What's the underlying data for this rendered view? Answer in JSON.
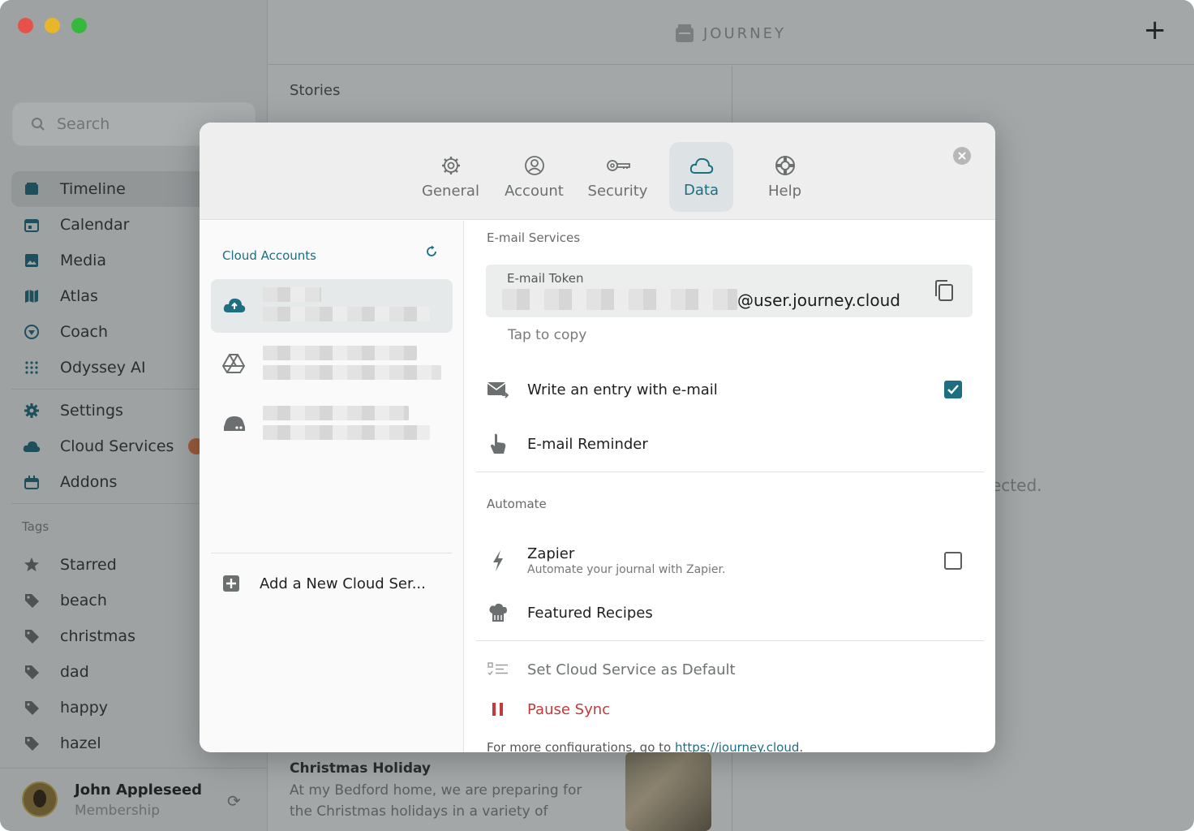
{
  "window": {
    "brand": "JOURNEY"
  },
  "sidebar": {
    "search_placeholder": "Search",
    "nav": [
      {
        "label": "Timeline",
        "icon": "timeline-icon"
      },
      {
        "label": "Calendar",
        "icon": "calendar-icon"
      },
      {
        "label": "Media",
        "icon": "media-icon"
      },
      {
        "label": "Atlas",
        "icon": "atlas-icon"
      },
      {
        "label": "Coach",
        "icon": "coach-icon"
      },
      {
        "label": "Odyssey AI",
        "icon": "odyssey-icon"
      }
    ],
    "nav2": [
      {
        "label": "Settings",
        "icon": "gear-icon"
      },
      {
        "label": "Cloud Services",
        "icon": "cloud-icon"
      },
      {
        "label": "Addons",
        "icon": "addons-icon"
      }
    ],
    "tags_title": "Tags",
    "tags": [
      "Starred",
      "beach",
      "christmas",
      "dad",
      "happy",
      "hazel"
    ],
    "user": {
      "name": "John Appleseed",
      "subtitle": "Membership"
    }
  },
  "stories": {
    "title": "Stories",
    "card": {
      "title": "Christmas Holiday",
      "body": "At my Bedford home, we are preparing for the Christmas holidays in a variety of"
    },
    "empty_fragment": "ected."
  },
  "modal": {
    "tabs": [
      {
        "label": "General",
        "icon": "gear-icon"
      },
      {
        "label": "Account",
        "icon": "account-icon"
      },
      {
        "label": "Security",
        "icon": "key-icon"
      },
      {
        "label": "Data",
        "icon": "cloud-icon",
        "active": true
      },
      {
        "label": "Help",
        "icon": "lifebuoy-icon"
      }
    ],
    "cloud_accounts_title": "Cloud Accounts",
    "add_service_label": "Add a New Cloud Ser...",
    "email_services_label": "E-mail Services",
    "email_token_label": "E-mail Token",
    "email_token_suffix": "@user.journey.cloud",
    "tap_to_copy": "Tap to copy",
    "write_entry_label": "Write an entry with e-mail",
    "write_entry_checked": true,
    "email_reminder_label": "E-mail Reminder",
    "automate_label": "Automate",
    "zapier_title": "Zapier",
    "zapier_subtitle": "Automate your journal with Zapier.",
    "zapier_checked": false,
    "featured_recipes_label": "Featured Recipes",
    "set_default_label": "Set Cloud Service as Default",
    "pause_sync_label": "Pause Sync",
    "footer_text": "For more configurations, go to ",
    "footer_link": "https://journey.cloud",
    "footer_end": "."
  },
  "colors": {
    "accent": "#1d6e80",
    "danger": "#c23a3a"
  }
}
